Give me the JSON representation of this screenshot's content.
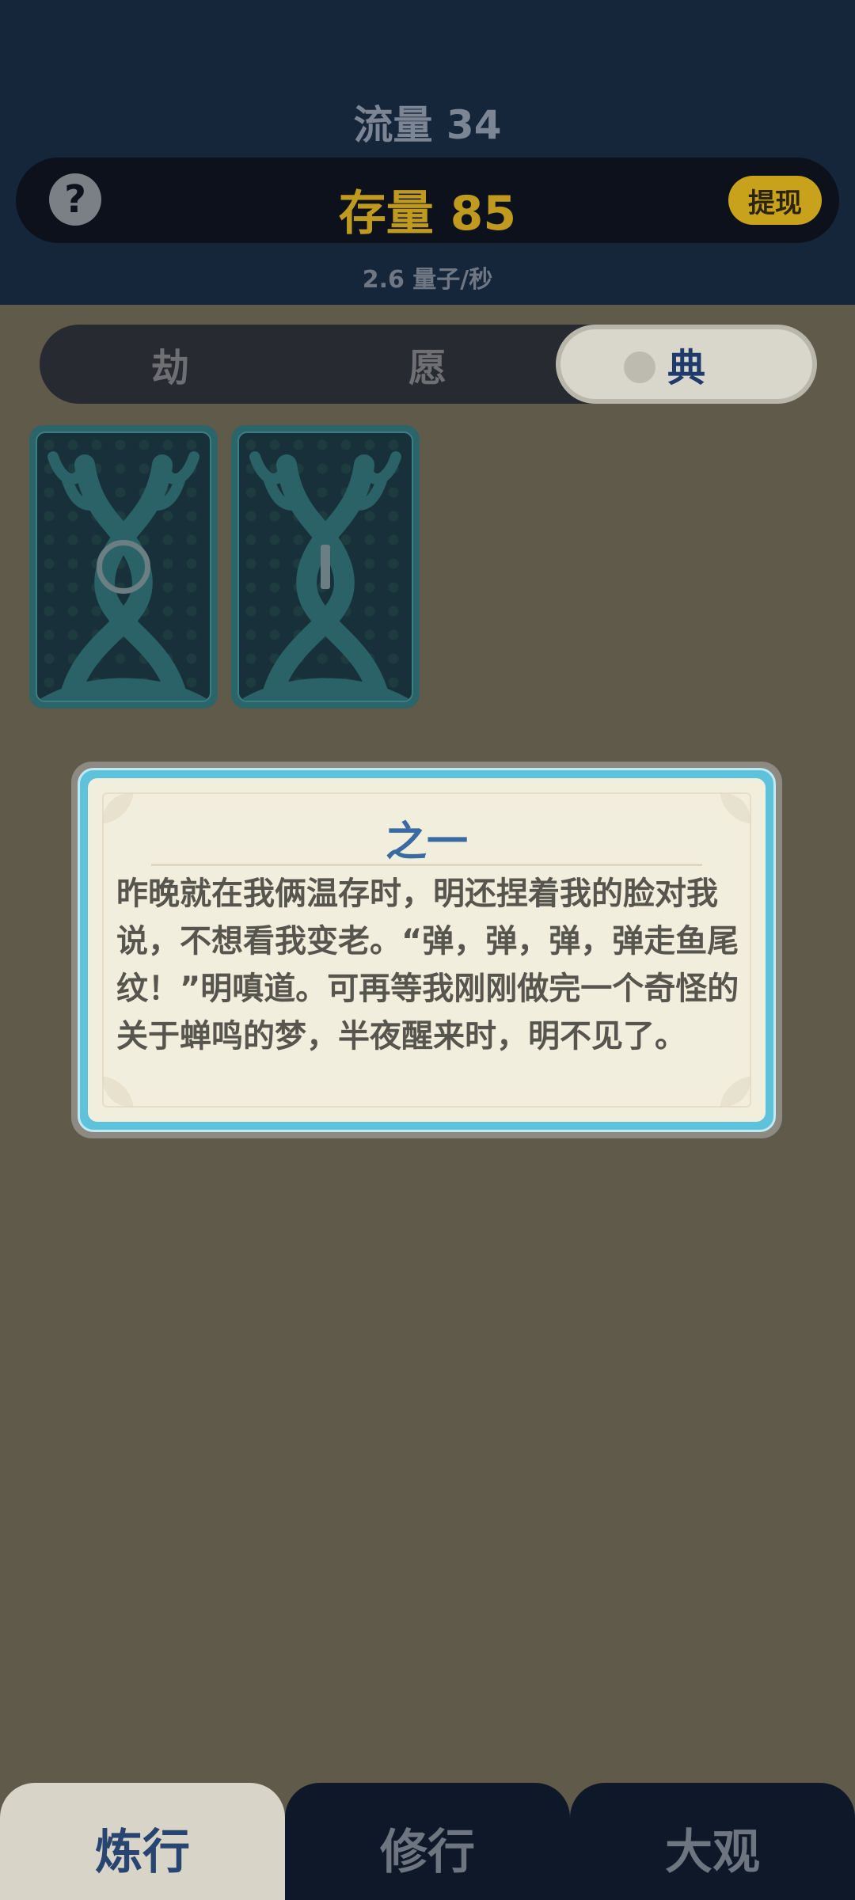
{
  "header": {
    "flow_text": "流量 34",
    "stock_text": "存量 85",
    "rate_text": "2.6  量子/秒",
    "help_label": "?",
    "withdraw_label": "提现"
  },
  "tabs": [
    {
      "label": "劫"
    },
    {
      "label": "愿"
    },
    {
      "label": "典",
      "active": true
    }
  ],
  "cards": [
    {
      "mark": "ring",
      "icon": "circle-mark-icon"
    },
    {
      "mark": "bar",
      "icon": "bar-mark-icon"
    }
  ],
  "dialog": {
    "title": "之一",
    "body": "昨晚就在我俩温存时，明还捏着我的脸对我说，不想看我变老。“弹，弹，弹，弹走鱼尾纹！”明嗔道。可再等我刚刚做完一个奇怪的关于蝉鸣的梦，半夜醒来时，明不见了。"
  },
  "bottom_nav": [
    {
      "label": "炼行",
      "active": true
    },
    {
      "label": "修行"
    },
    {
      "label": "大观"
    }
  ],
  "colors": {
    "header_bg": "#15253a",
    "gold": "#c09a1e",
    "page_bg": "#5f5a4a",
    "dialog_border": "#5ec2da",
    "title_blue": "#3a6aa2"
  }
}
